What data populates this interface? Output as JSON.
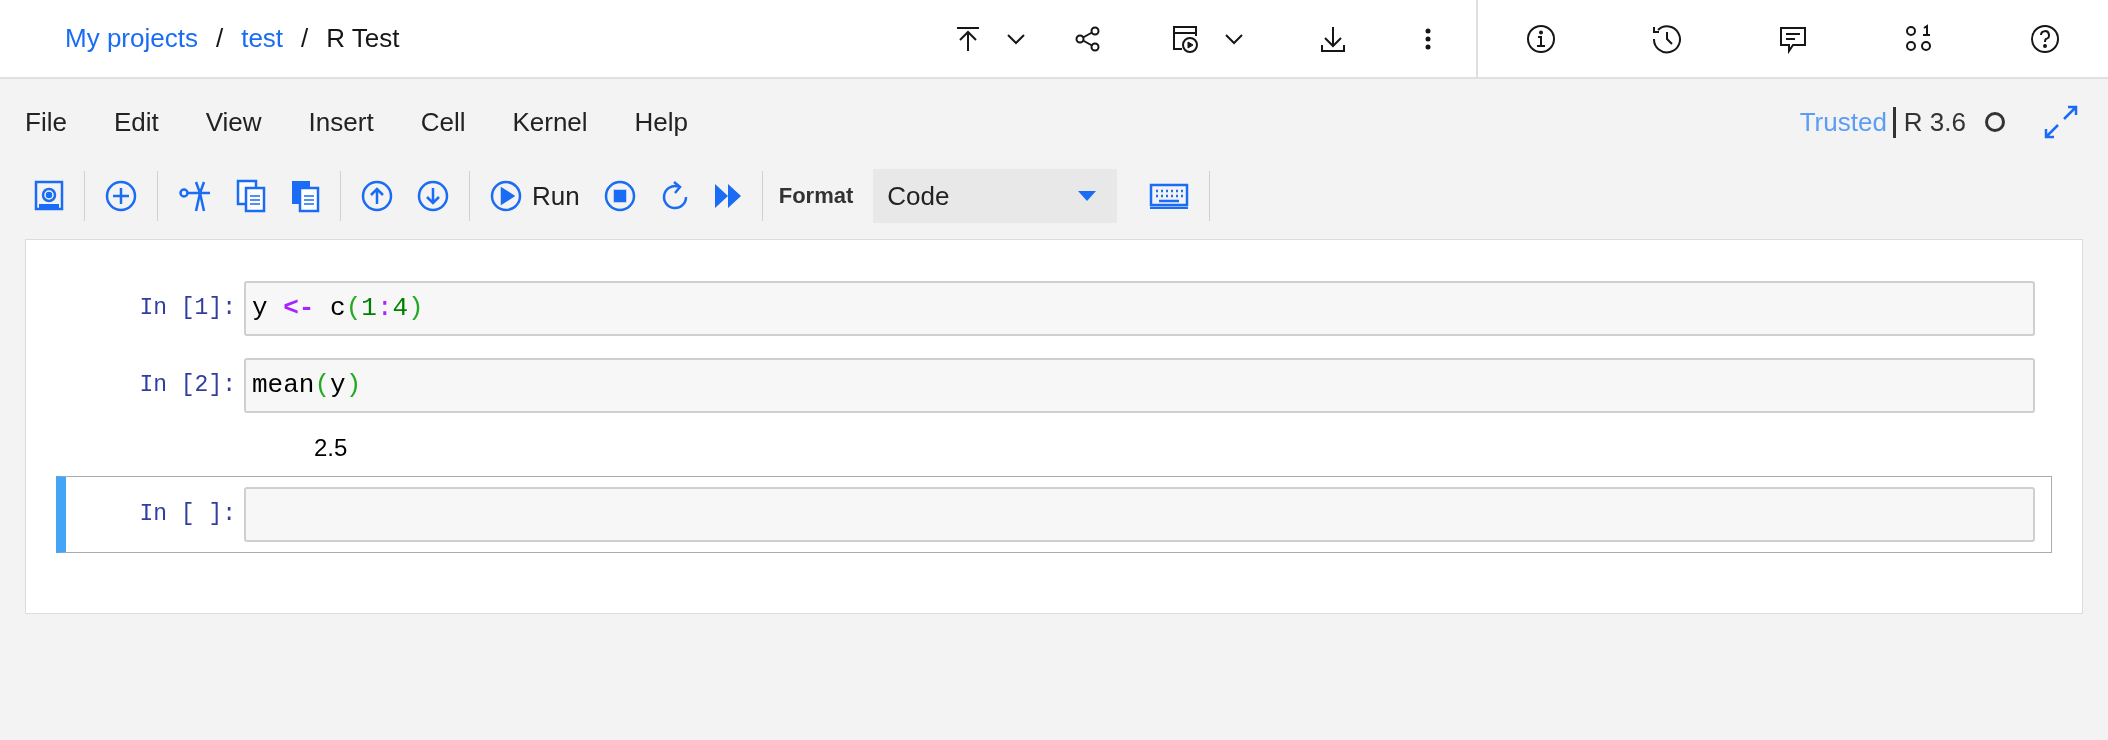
{
  "breadcrumb": {
    "items": [
      {
        "label": "My projects",
        "kind": "link"
      },
      {
        "label": "test",
        "kind": "link"
      },
      {
        "label": "R Test",
        "kind": "current"
      }
    ],
    "separator": "/"
  },
  "menu": [
    "File",
    "Edit",
    "View",
    "Insert",
    "Cell",
    "Kernel",
    "Help"
  ],
  "status": {
    "trusted": "Trusted",
    "kernel": "R 3.6"
  },
  "toolbar": {
    "run_label": "Run",
    "format_label": "Format",
    "cell_type": "Code"
  },
  "cells": [
    {
      "prompt": "In [1]:",
      "selected": false,
      "code": [
        {
          "text": "y ",
          "kind": "var"
        },
        {
          "text": "<-",
          "kind": "op"
        },
        {
          "text": " c",
          "kind": "var"
        },
        {
          "text": "(",
          "kind": "paren"
        },
        {
          "text": "1",
          "kind": "num"
        },
        {
          "text": ":",
          "kind": "op2"
        },
        {
          "text": "4",
          "kind": "num"
        },
        {
          "text": ")",
          "kind": "paren"
        }
      ]
    },
    {
      "prompt": "In [2]:",
      "selected": false,
      "code": [
        {
          "text": "mean",
          "kind": "var"
        },
        {
          "text": "(",
          "kind": "paren"
        },
        {
          "text": "y",
          "kind": "var"
        },
        {
          "text": ")",
          "kind": "paren"
        }
      ],
      "output": "2.5"
    },
    {
      "prompt": "In [ ]:",
      "selected": true
    }
  ]
}
